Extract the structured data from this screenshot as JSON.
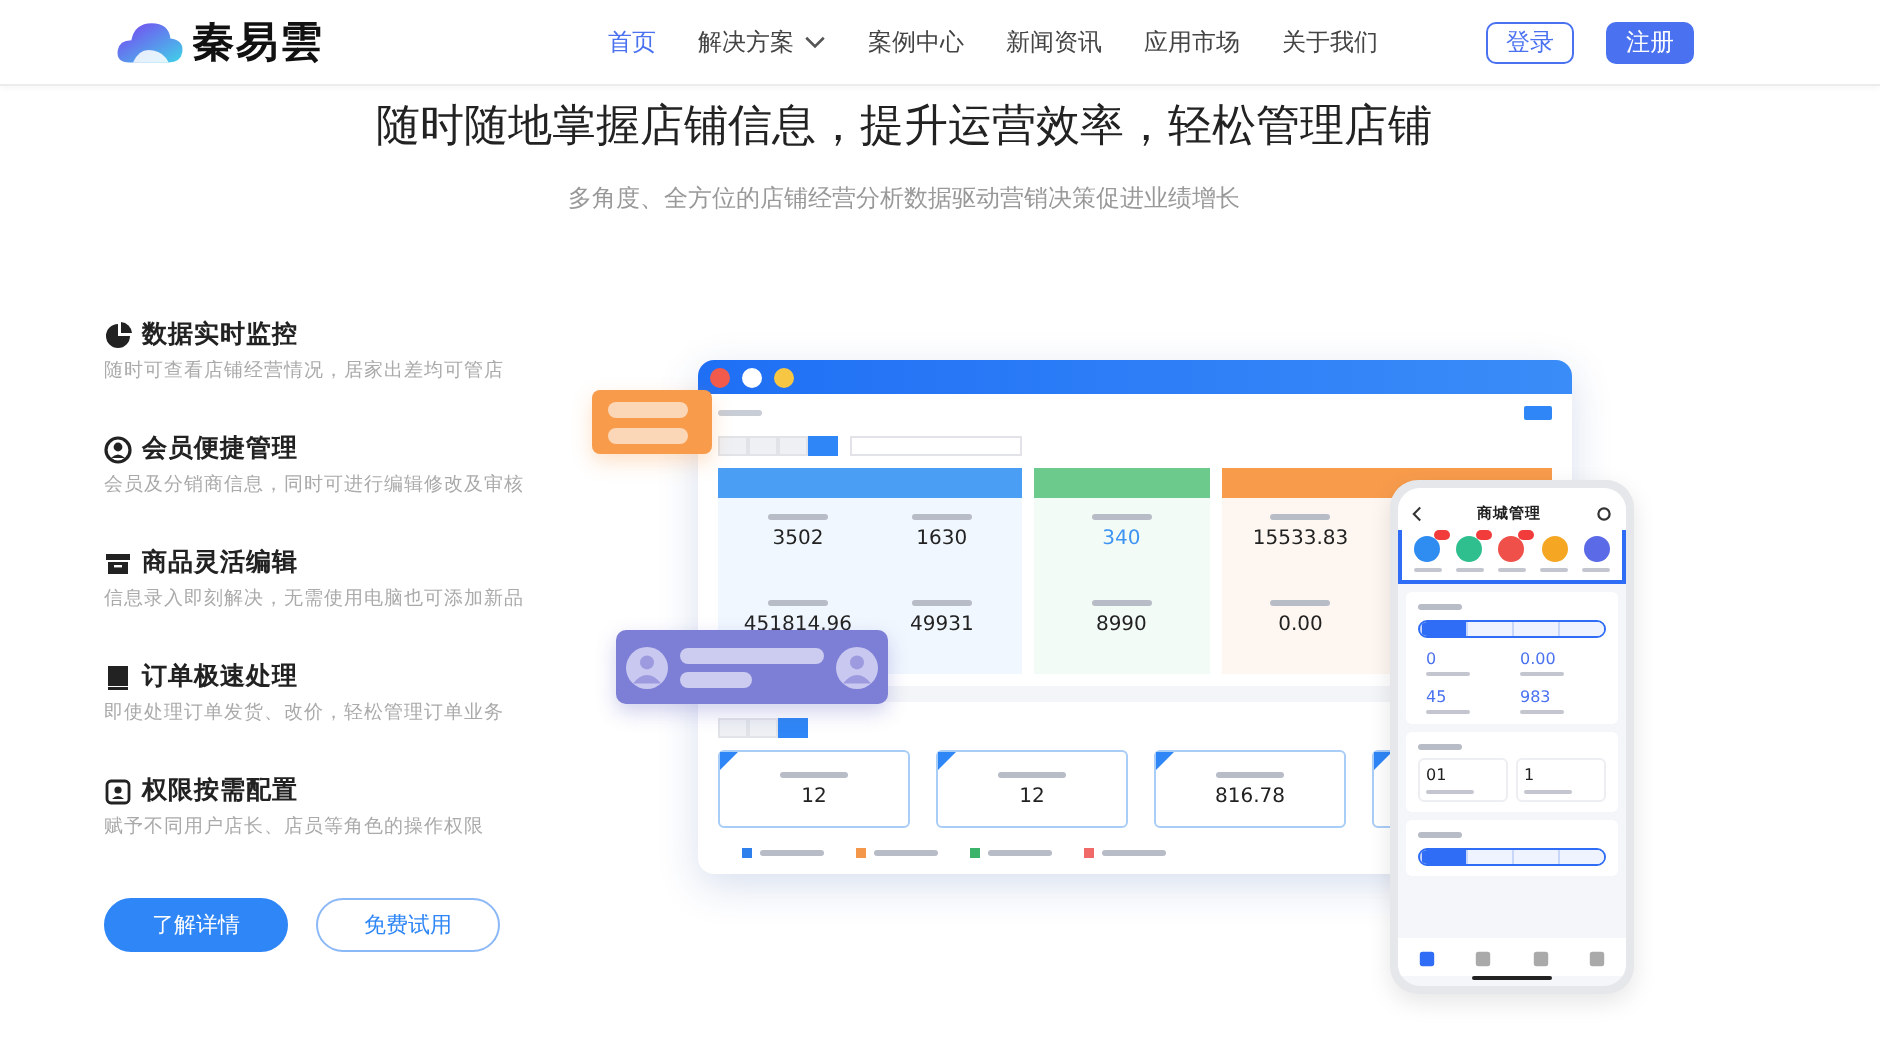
{
  "header": {
    "logo": "秦易雲",
    "nav": [
      {
        "label": "首页",
        "selected": true,
        "dropdown": false
      },
      {
        "label": "解决方案",
        "selected": false,
        "dropdown": true
      },
      {
        "label": "案例中心",
        "selected": false,
        "dropdown": false
      },
      {
        "label": "新闻资讯",
        "selected": false,
        "dropdown": false
      },
      {
        "label": "应用市场",
        "selected": false,
        "dropdown": false
      },
      {
        "label": "关于我们",
        "selected": false,
        "dropdown": false
      }
    ],
    "login": "登录",
    "register": "注册"
  },
  "hero": {
    "title": "随时随地掌握店铺信息，提升运营效率，轻松管理店铺",
    "subtitle": "多角度、全方位的店铺经营分析数据驱动营销决策促进业绩增长"
  },
  "features": [
    {
      "kind": "pie",
      "title": "数据实时监控",
      "desc": "随时可查看店铺经营情况，居家出差均可管店"
    },
    {
      "kind": "member",
      "title": "会员便捷管理",
      "desc": "会员及分销商信息，同时可进行编辑修改及审核"
    },
    {
      "kind": "box",
      "title": "商品灵活编辑",
      "desc": "信息录入即刻解决，无需使用电脑也可添加新品"
    },
    {
      "kind": "book",
      "title": "订单极速处理",
      "desc": "即使处理订单发货、改价，轻松管理订单业务"
    },
    {
      "kind": "badge",
      "title": "权限按需配置",
      "desc": "赋予不同用户店长、店员等角色的操作权限"
    }
  ],
  "actions": {
    "primary": "了解详情",
    "secondary": "免费试用"
  },
  "mockup": {
    "dashboard": {
      "range_tabs": [
        {
          "selected": false
        },
        {
          "selected": false
        },
        {
          "selected": false
        },
        {
          "selected": true
        }
      ],
      "panels": [
        {
          "color": "#4a9ff5",
          "stats": [
            {
              "value": "3502",
              "accent": false
            },
            {
              "value": "1630",
              "accent": false
            },
            {
              "value": "451814.96",
              "accent": false
            },
            {
              "value": "49931",
              "accent": false
            }
          ]
        },
        {
          "color": "#6ccb8c",
          "stats": [
            {
              "value": "340",
              "accent": true
            },
            {
              "value": "8990",
              "accent": false
            }
          ]
        },
        {
          "color": "#f89b4b",
          "stats": [
            {
              "value": "15533.83",
              "accent": false
            },
            {
              "value": "0.00",
              "accent": false
            }
          ]
        }
      ],
      "period_tabs": [
        {
          "selected": false
        },
        {
          "selected": false
        },
        {
          "selected": true
        }
      ],
      "cards": [
        "12",
        "12",
        "816.78"
      ],
      "legend": [
        {
          "color": "#2f80ed"
        },
        {
          "color": "#f5974a"
        },
        {
          "color": "#3bb36a"
        },
        {
          "color": "#f06a6a"
        }
      ]
    },
    "phone": {
      "title": "商城管理",
      "shortcuts": [
        {
          "color": "#2f8cf0",
          "badge": true
        },
        {
          "color": "#2fbf8f",
          "badge": true
        },
        {
          "color": "#f0504a",
          "badge": true
        },
        {
          "color": "#f5a623",
          "badge": false
        },
        {
          "color": "#5b6be8",
          "badge": false
        }
      ],
      "tabs": [
        {
          "selected": true
        },
        {
          "selected": false
        },
        {
          "selected": false
        },
        {
          "selected": false
        }
      ],
      "stats": [
        "0",
        "0.00",
        "45",
        "983"
      ],
      "quick": [
        "01",
        "1"
      ],
      "tabs2": [
        {
          "selected": true
        },
        {
          "selected": false
        },
        {
          "selected": false
        },
        {
          "selected": false
        }
      ],
      "navbar": [
        {
          "selected": true
        },
        {
          "selected": false
        },
        {
          "selected": false
        },
        {
          "selected": false
        }
      ]
    }
  }
}
